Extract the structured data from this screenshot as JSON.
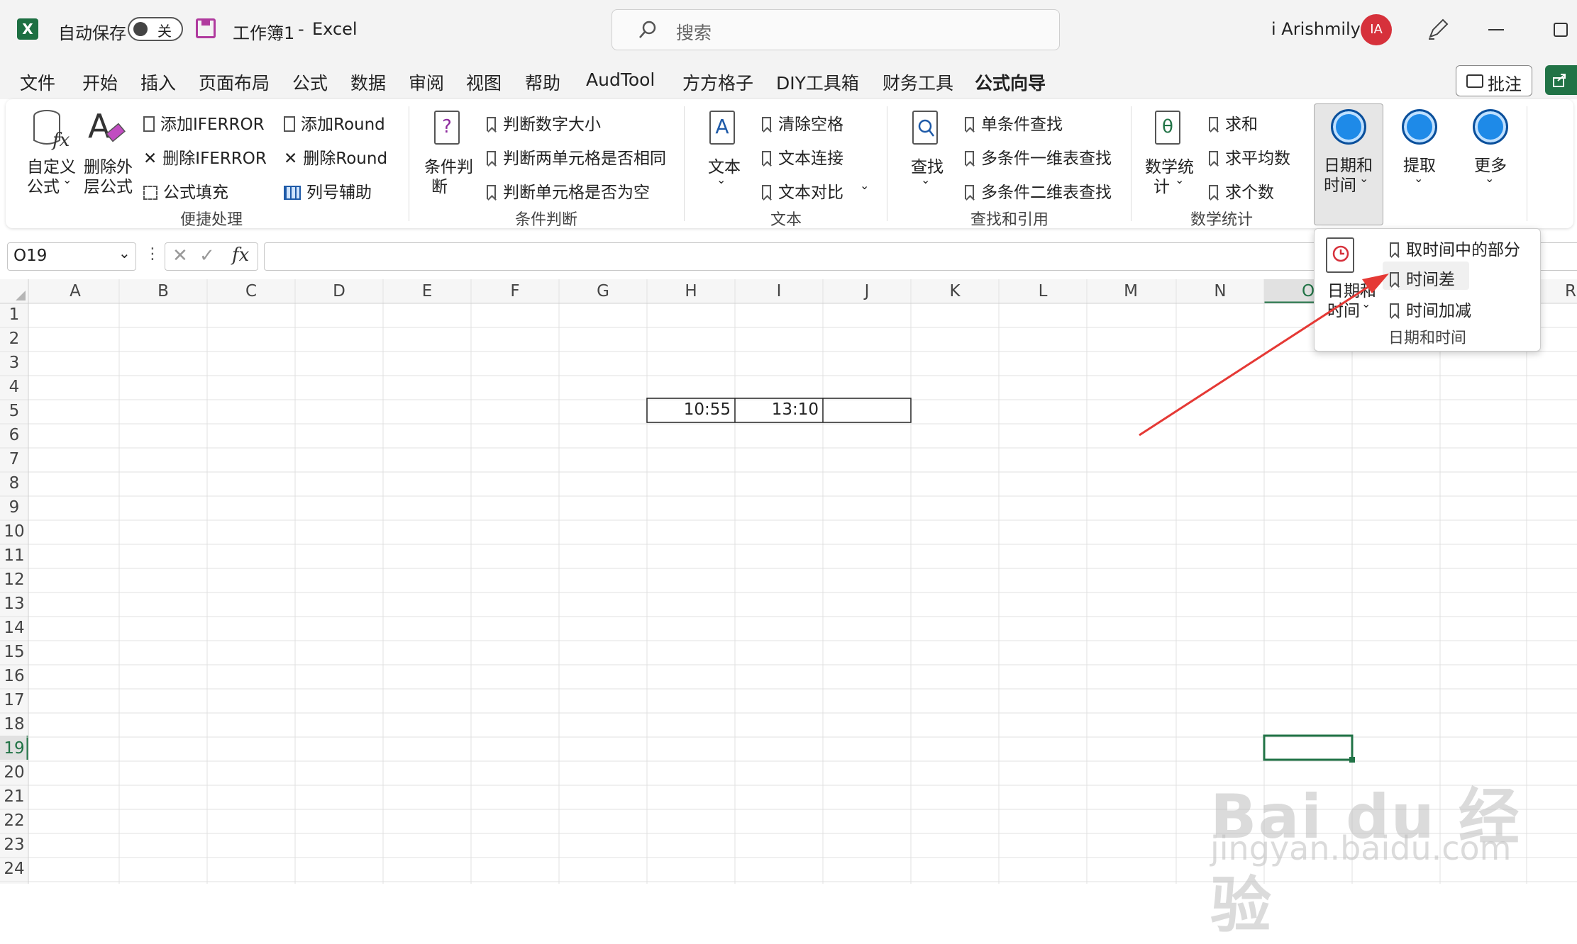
{
  "titlebar": {
    "autosave_label": "自动保存",
    "autosave_state": "关",
    "doc_title": "工作簿1",
    "separator": "-",
    "app_name": "Excel",
    "search_placeholder": "搜索",
    "user_name": "i Arishmily",
    "avatar_initials": "IA"
  },
  "menubar": {
    "tabs": [
      "文件",
      "开始",
      "插入",
      "页面布局",
      "公式",
      "数据",
      "审阅",
      "视图",
      "帮助",
      "AudTool",
      "方方格子",
      "DIY工具箱",
      "财务工具",
      "公式向导"
    ],
    "active_tab": "公式向导",
    "comment_button": "批注"
  },
  "ribbon": {
    "quick": {
      "custom_formula_line1": "自定义",
      "custom_formula_line2": "公式",
      "delete_outer_line1": "删除外",
      "delete_outer_line2": "层公式",
      "add_iferror": "添加IFERROR",
      "del_iferror": "删除IFERROR",
      "fill_formula": "公式填充",
      "add_round": "添加Round",
      "del_round": "删除Round",
      "col_helper": "列号辅助",
      "group_label": "便捷处理"
    },
    "cond": {
      "big_line1": "条件判",
      "big_line2": "断",
      "items": [
        "判断数字大小",
        "判断两单元格是否相同",
        "判断单元格是否为空"
      ],
      "group_label": "条件判断"
    },
    "text": {
      "big_label": "文本",
      "items": [
        "清除空格",
        "文本连接",
        "文本对比"
      ],
      "group_label": "文本"
    },
    "lookup": {
      "big_label": "查找",
      "items": [
        "单条件查找",
        "多条件一维表查找",
        "多条件二维表查找"
      ],
      "group_label": "查找和引用"
    },
    "math": {
      "big_line1": "数学统",
      "big_line2": "计",
      "items": [
        "求和",
        "求平均数",
        "求个数"
      ],
      "group_label": "数学统计"
    },
    "datetime": {
      "line1": "日期和",
      "line2": "时间"
    },
    "extract": "提取",
    "more": "更多"
  },
  "formula_bar": {
    "name_box": "O19",
    "fx": "fx",
    "content": ""
  },
  "grid": {
    "columns": [
      "A",
      "B",
      "C",
      "D",
      "E",
      "F",
      "G",
      "H",
      "I",
      "J",
      "K",
      "L",
      "M",
      "N",
      "O",
      "R"
    ],
    "rows": [
      "1",
      "2",
      "3",
      "4",
      "5",
      "6",
      "7",
      "8",
      "9",
      "10",
      "11",
      "12",
      "13",
      "14",
      "15",
      "16",
      "17",
      "18",
      "19",
      "20",
      "21",
      "22",
      "23",
      "24"
    ],
    "selected_cell": "O19",
    "cells": {
      "H5": "10:55",
      "I5": "13:10",
      "J5": ""
    }
  },
  "dropdown": {
    "big_line1": "日期和",
    "big_line2": "时间",
    "items": [
      "取时间中的部分",
      "时间差",
      "时间加减"
    ],
    "hovered_item": "时间差",
    "group_label": "日期和时间"
  },
  "watermark": {
    "logo": "Bai du 经验",
    "url": "jingyan.baidu.com"
  },
  "colors": {
    "excel_green": "#217346",
    "arrow_red": "#e53935",
    "avatar_red": "#d6313b",
    "accent_blue": "#1e8ae8"
  }
}
